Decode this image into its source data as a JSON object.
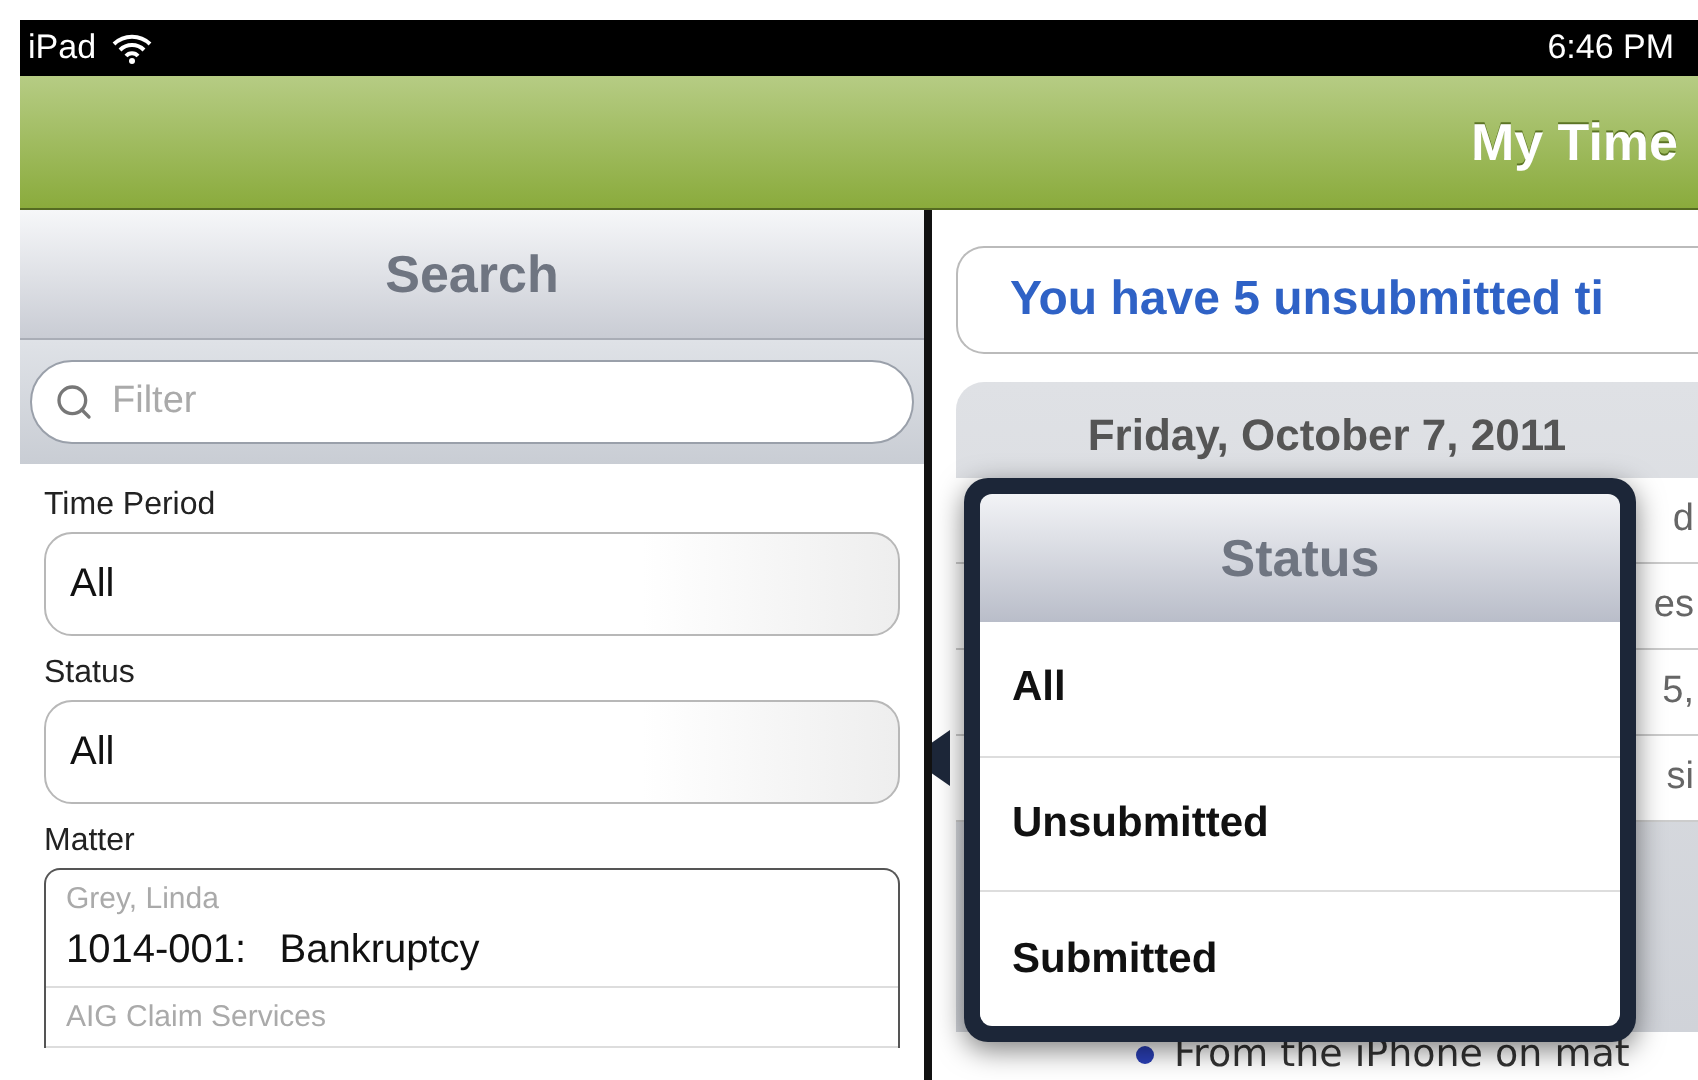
{
  "status_bar": {
    "device": "iPad",
    "time": "6:46 PM"
  },
  "nav_bar": {
    "title": "My Time"
  },
  "search_panel": {
    "title": "Search",
    "filter": {
      "placeholder": "Filter"
    },
    "fields": [
      {
        "label": "Time Period",
        "value": "All"
      },
      {
        "label": "Status",
        "value": "All"
      }
    ],
    "matter": {
      "label": "Matter",
      "items": [
        {
          "client": "Grey, Linda",
          "matter": "1014-001:   Bankruptcy"
        },
        {
          "client": "AIG Claim Services"
        }
      ]
    }
  },
  "main": {
    "banner": "You have 5 unsubmitted ti",
    "date_header": "Friday, October 7, 2011",
    "fragments": [
      "d",
      "es",
      "5,",
      "si"
    ],
    "entry_note": "From the iPhone on mat"
  },
  "popover": {
    "title": "Status",
    "options": [
      "All",
      "Unsubmitted",
      "Submitted"
    ]
  }
}
